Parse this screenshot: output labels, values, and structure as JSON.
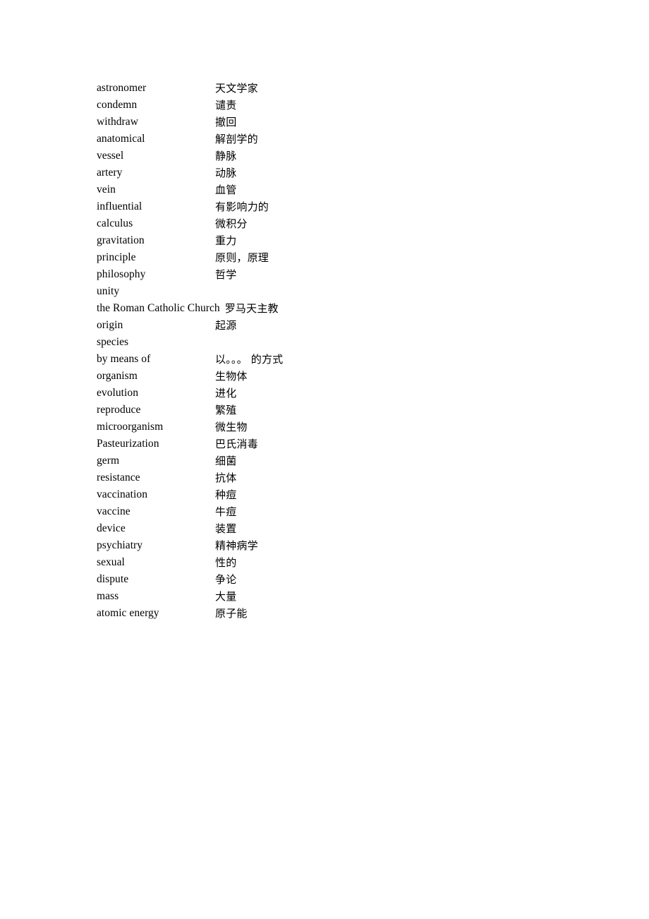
{
  "document": {
    "type": "vocabulary-word-list",
    "background_color": "#ffffff",
    "text_color": "#000000",
    "columns": {
      "term_header": "",
      "gloss_header": ""
    }
  },
  "entries": [
    {
      "term": "astronomer",
      "gloss": "天文学家"
    },
    {
      "term": "condemn",
      "gloss": "谴责"
    },
    {
      "term": "withdraw",
      "gloss": "撤回"
    },
    {
      "term": "anatomical",
      "gloss": "解剖学的"
    },
    {
      "term": "vessel",
      "gloss": "静脉"
    },
    {
      "term": "artery",
      "gloss": "动脉"
    },
    {
      "term": "vein",
      "gloss": "血管"
    },
    {
      "term": "influential",
      "gloss": "有影响力的"
    },
    {
      "term": "calculus",
      "gloss": "微积分"
    },
    {
      "term": "gravitation",
      "gloss": "重力"
    },
    {
      "term": "principle",
      "gloss": "原则，原理"
    },
    {
      "term": "philosophy",
      "gloss": "哲学"
    },
    {
      "term": "unity",
      "gloss": ""
    },
    {
      "term": "the Roman Catholic Church",
      "gloss": "罗马天主教"
    },
    {
      "term": "origin",
      "gloss": "起源"
    },
    {
      "term": "species",
      "gloss": ""
    },
    {
      "term": "by means of",
      "gloss": "以。。。 的方式"
    },
    {
      "term": "organism",
      "gloss": "生物体"
    },
    {
      "term": "evolution",
      "gloss": "进化"
    },
    {
      "term": "reproduce",
      "gloss": "繁殖"
    },
    {
      "term": "microorganism",
      "gloss": "微生物"
    },
    {
      "term": "Pasteurization",
      "gloss": "巴氏消毒"
    },
    {
      "term": "germ",
      "gloss": "细菌"
    },
    {
      "term": "resistance",
      "gloss": "抗体"
    },
    {
      "term": "vaccination",
      "gloss": "种痘"
    },
    {
      "term": "vaccine",
      "gloss": "牛痘"
    },
    {
      "term": "device",
      "gloss": "装置"
    },
    {
      "term": "psychiatry",
      "gloss": "精神病学"
    },
    {
      "term": "sexual",
      "gloss": "性的"
    },
    {
      "term": "dispute",
      "gloss": "争论"
    },
    {
      "term": "mass",
      "gloss": "大量"
    },
    {
      "term": "atomic energy",
      "gloss": "原子能"
    }
  ]
}
